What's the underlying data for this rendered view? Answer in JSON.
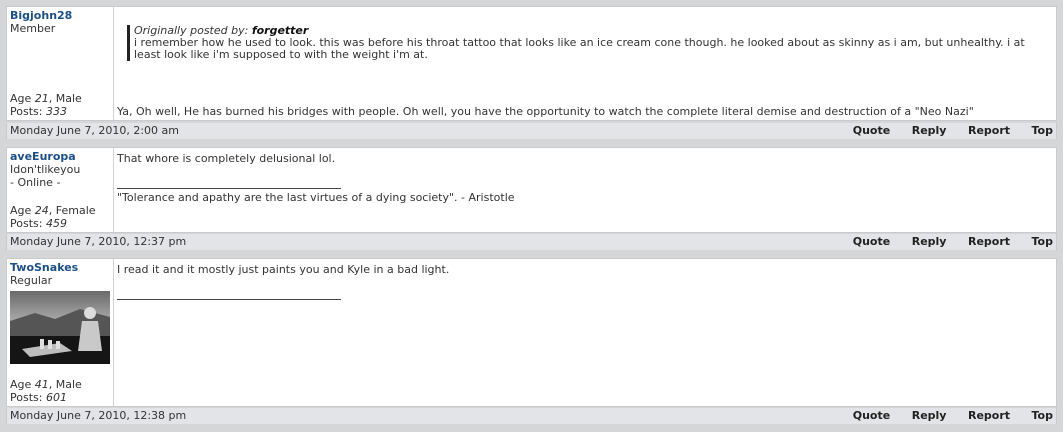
{
  "posts": [
    {
      "username": "Bigjohn28",
      "title": "Member",
      "online": "",
      "age_label": "Age",
      "age": "21",
      "gender": ", Male",
      "posts_label": "Posts:",
      "posts": "333",
      "quote_prefix": "Originally posted by:",
      "quote_author": "forgetter",
      "quote_text": "i remember how he used to look. this was before his throat tattoo that looks like an ice cream cone though. he looked about as skinny as i am, but unhealthy. i at least look like i'm supposed to with the weight i'm at.",
      "message": "Ya, Oh well, He has burned his bridges with people. Oh well, you have the opportunity to watch the complete literal demise and destruction of a \"Neo Nazi\"",
      "signature": "",
      "date": "Monday June 7, 2010, 2:00 am"
    },
    {
      "username": "aveEuropa",
      "title": "Idon'tlikeyou",
      "online": "- Online -",
      "age_label": "Age",
      "age": "24",
      "gender": ", Female",
      "posts_label": "Posts:",
      "posts": "459",
      "message": "That whore is completely delusional lol.",
      "signature": "\"Tolerance and apathy are the last virtues of a dying society\". - Aristotle",
      "date": "Monday June 7, 2010, 12:37 pm"
    },
    {
      "username": "TwoSnakes",
      "title": "Regular",
      "online": "",
      "age_label": "Age",
      "age": "41",
      "gender": ", Male",
      "posts_label": "Posts:",
      "posts": "601",
      "message": "I read it and it mostly just paints you and Kyle in a bad light.",
      "signature": "",
      "date": "Monday June 7, 2010, 12:38 pm"
    }
  ],
  "actions": {
    "quote": "Quote",
    "reply": "Reply",
    "report": "Report",
    "top": "Top"
  },
  "colors": {
    "username": "#1b4f86",
    "footer_bg": "#e2e4e7",
    "page_bg": "#d4d6d8"
  }
}
